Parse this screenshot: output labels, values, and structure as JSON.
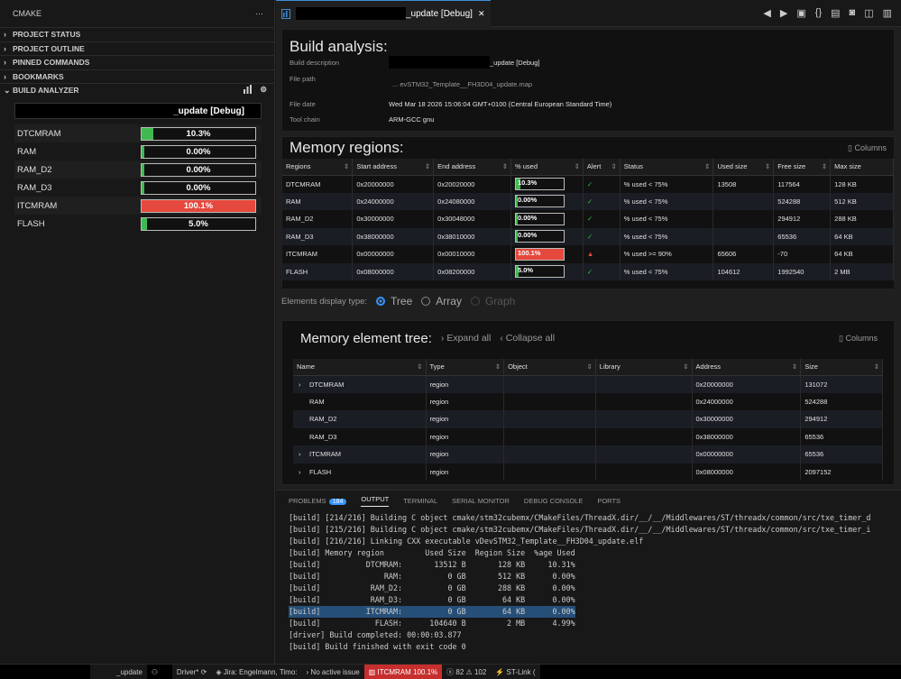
{
  "sidebar": {
    "title": "CMAKE",
    "more": "···",
    "sections": [
      "PROJECT STATUS",
      "PROJECT OUTLINE",
      "PINNED COMMANDS",
      "BOOKMARKS",
      "BUILD ANALYZER"
    ],
    "panel_title": "_update [Debug]",
    "regions": [
      {
        "name": "DTCMRAM",
        "pct": "10.3%",
        "fill": 0.103,
        "color": "#3fb950"
      },
      {
        "name": "RAM",
        "pct": "0.00%",
        "fill": 0.0,
        "color": "#3fb950"
      },
      {
        "name": "RAM_D2",
        "pct": "0.00%",
        "fill": 0.0,
        "color": "#3fb950"
      },
      {
        "name": "RAM_D3",
        "pct": "0.00%",
        "fill": 0.0,
        "color": "#3fb950"
      },
      {
        "name": "ITCMRAM",
        "pct": "100.1%",
        "fill": 1.0,
        "color": "#e5483c"
      },
      {
        "name": "FLASH",
        "pct": "5.0%",
        "fill": 0.05,
        "color": "#3fb950"
      }
    ]
  },
  "tab": {
    "label": "_update [Debug]",
    "close": "✕"
  },
  "build": {
    "title": "Build analysis:",
    "desc_label": "Build description",
    "desc_value": "_update [Debug]",
    "path_label": "File path",
    "path_value": "... evSTM32_Template__FH3D04_update.map",
    "date_label": "File date",
    "date_value": "Wed Mar 18 2026 15:06:04 GMT+0100 (Central European Standard Time)",
    "tool_label": "Tool chain",
    "tool_value": "ARM-GCC gnu"
  },
  "memory": {
    "title": "Memory regions:",
    "columns_btn": "Columns",
    "headers": [
      "Regions",
      "Start address",
      "End address",
      "% used",
      "Alert",
      "Status",
      "Used size",
      "Free size",
      "Max size"
    ],
    "rows": [
      {
        "name": "DTCMRAM",
        "start": "0x20000000",
        "end": "0x20020000",
        "pct": "10.3%",
        "fill": 0.103,
        "alert": "ok",
        "status": "% used < 75%",
        "used": "13508",
        "free": "117564",
        "max": "128 KB"
      },
      {
        "name": "RAM",
        "start": "0x24000000",
        "end": "0x24080000",
        "pct": "0.00%",
        "fill": 0.0,
        "alert": "ok",
        "status": "% used < 75%",
        "used": "",
        "free": "524288",
        "max": "512 KB"
      },
      {
        "name": "RAM_D2",
        "start": "0x30000000",
        "end": "0x30048000",
        "pct": "0.00%",
        "fill": 0.0,
        "alert": "ok",
        "status": "% used < 75%",
        "used": "",
        "free": "294912",
        "max": "288 KB"
      },
      {
        "name": "RAM_D3",
        "start": "0x38000000",
        "end": "0x38010000",
        "pct": "0.00%",
        "fill": 0.0,
        "alert": "ok",
        "status": "% used < 75%",
        "used": "",
        "free": "65536",
        "max": "64 KB"
      },
      {
        "name": "ITCMRAM",
        "start": "0x00000000",
        "end": "0x00010000",
        "pct": "100.1%",
        "fill": 1.0,
        "alert": "warn",
        "status": "% used >= 90%",
        "used": "65606",
        "free": "-70",
        "max": "64 KB"
      },
      {
        "name": "FLASH",
        "start": "0x08000000",
        "end": "0x08200000",
        "pct": "5.0%",
        "fill": 0.05,
        "alert": "ok",
        "status": "% used < 75%",
        "used": "104612",
        "free": "1992540",
        "max": "2 MB"
      }
    ]
  },
  "display": {
    "label": "Elements display type:",
    "options": [
      "Tree",
      "Array",
      "Graph"
    ]
  },
  "tree": {
    "title": "Memory element tree:",
    "expand": "Expand all",
    "collapse": "Collapse all",
    "columns_btn": "Columns",
    "headers": [
      "Name",
      "Type",
      "Object",
      "Library",
      "Address",
      "Size"
    ],
    "rows": [
      {
        "name": "DTCMRAM",
        "type": "region",
        "address": "0x20000000",
        "size": "131072",
        "chev": true
      },
      {
        "name": "RAM",
        "type": "region",
        "address": "0x24000000",
        "size": "524288",
        "chev": false
      },
      {
        "name": "RAM_D2",
        "type": "region",
        "address": "0x30000000",
        "size": "294912",
        "chev": false
      },
      {
        "name": "RAM_D3",
        "type": "region",
        "address": "0x38000000",
        "size": "65536",
        "chev": false
      },
      {
        "name": "ITCMRAM",
        "type": "region",
        "address": "0x00000000",
        "size": "65536",
        "chev": true
      },
      {
        "name": "FLASH",
        "type": "region",
        "address": "0x08000000",
        "size": "2097152",
        "chev": true
      }
    ]
  },
  "panel": {
    "tabs": [
      "PROBLEMS",
      "OUTPUT",
      "TERMINAL",
      "SERIAL MONITOR",
      "DEBUG CONSOLE",
      "PORTS"
    ],
    "problems_count": "184",
    "lines": [
      "[build] [214/216] Building C object cmake/stm32cubemx/CMakeFiles/ThreadX.dir/__/__/Middlewares/ST/threadx/common/src/txe_timer_d",
      "[build] [215/216] Building C object cmake/stm32cubemx/CMakeFiles/ThreadX.dir/__/__/Middlewares/ST/threadx/common/src/txe_timer_i",
      "[build] [216/216] Linking CXX executable vDevSTM32_Template__FH3D04_update.elf",
      "[build] Memory region         Used Size  Region Size  %age Used",
      "[build]          DTCMRAM:       13512 B       128 KB     10.31%",
      "[build]              RAM:          0 GB       512 KB      0.00%",
      "[build]           RAM_D2:          0 GB       288 KB      0.00%",
      "[build]           RAM_D3:          0 GB        64 KB      0.00%",
      "[build]          ITCMRAM:          0 GB        64 KB      0.00%",
      "[build]            FLASH:      104640 B         2 MB      4.99%",
      "[driver] Build completed: 00:00:03.877",
      "[build] Build finished with exit code 0"
    ]
  },
  "status": {
    "branch": "_update",
    "driver": "Driver*",
    "jira": "Jira: Engelmann, Timo:",
    "issue": "No active issue",
    "itcm": "ITCMRAM 100.1%",
    "errors": "82",
    "warnings": "102",
    "stlink": "ST-Link ("
  }
}
